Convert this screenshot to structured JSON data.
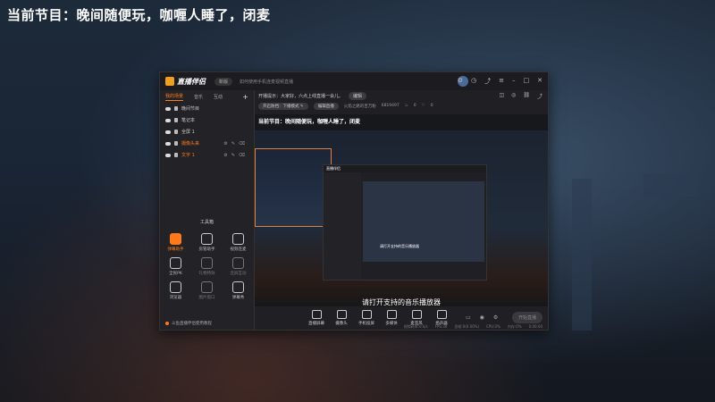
{
  "page_title": "当前节目：晚间随便玩，咖喱人睡了，闭麦",
  "app": {
    "logo_text": "直播伴侣",
    "version_badge": "新版",
    "guide_link": "如何使用手机连麦视频直播",
    "window_controls": [
      "settings-icon",
      "notice-icon",
      "share-icon",
      "menu-icon",
      "minimize-icon",
      "maximize-icon",
      "close-icon"
    ]
  },
  "left_panel": {
    "tabs": [
      "我的场景",
      "音乐",
      "互动"
    ],
    "add_label": "+",
    "sources": [
      {
        "name": "晚间节目",
        "highlight": false
      },
      {
        "name": "笔记本",
        "highlight": false
      },
      {
        "name": "全屏 1",
        "highlight": false
      },
      {
        "name": "摄像头来",
        "highlight": true
      },
      {
        "name": "文字 1",
        "highlight": true
      }
    ],
    "toolbox_title": "工具箱",
    "tools": [
      {
        "label": "弹幕助手",
        "style": "orange"
      },
      {
        "label": "房管助手",
        "style": "normal"
      },
      {
        "label": "视频连麦",
        "style": "normal"
      },
      {
        "label": "全民PK",
        "style": "normal"
      },
      {
        "label": "礼物特效",
        "style": "dim"
      },
      {
        "label": "连屏互动",
        "style": "dim"
      },
      {
        "label": "浏览器",
        "style": "normal"
      },
      {
        "label": "图片窗口",
        "style": "dim"
      },
      {
        "label": "弹幕秀",
        "style": "normal"
      }
    ],
    "footer": "斗鱼直播伴侣使用教程"
  },
  "top_bar": {
    "announce_label": "开播提示：大家好，六点上线直播一会儿。",
    "edit_chip": "编辑",
    "tags_chip": "开启防挡：下播模式 ✎",
    "category_chip": "编辑直播",
    "room_info": "火焰之路的百万粉",
    "room_id": "6819497",
    "fans": "0",
    "likes": "0",
    "right_icons": [
      "gift-icon",
      "record-icon",
      "link-icon",
      "share-icon"
    ]
  },
  "preview": {
    "title": "当前节目：晚间随便玩，咖喱人睡了，闭麦",
    "inner_caption": "请打开支持的音乐播放器",
    "inner_logo": "直播伴侣",
    "hint": "请打开支持的音乐播放器"
  },
  "controls": [
    {
      "label": "直播屏幕",
      "icon": "screen-icon"
    },
    {
      "label": "摄像头",
      "icon": "camera-icon"
    },
    {
      "label": "手机投屏",
      "icon": "phone-icon"
    },
    {
      "label": "多媒体",
      "icon": "media-icon"
    },
    {
      "label": "麦克风",
      "icon": "mic-icon"
    },
    {
      "label": "扬声器",
      "icon": "speaker-icon"
    }
  ],
  "start_button": "开始直播",
  "status_bar": [
    "视频码率:0 k/s",
    "FPS:30",
    "丢帧:0(0.00%)",
    "CPU:0%",
    "内存:0%",
    "0:00:00"
  ]
}
